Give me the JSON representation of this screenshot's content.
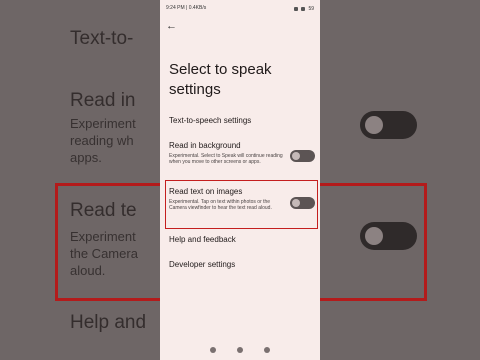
{
  "status_bar": {
    "time": "9:24 PM | 0.4KB/s",
    "battery": "59"
  },
  "screen": {
    "title": "Select to speak settings",
    "back_icon": "arrow-left-icon",
    "items": [
      {
        "label": "Text-to-speech settings"
      },
      {
        "label": "Read in background",
        "description": "Experimental. Select to Speak will continue reading when you move to other screens or apps.",
        "toggle_on": false
      },
      {
        "label": "Read text on images",
        "description": "Experimental. Tap on text within photos or the Camera viewfinder to hear the text read aloud.",
        "toggle_on": false
      },
      {
        "label": "Help and feedback"
      },
      {
        "label": "Developer settings"
      }
    ],
    "highlight_color": "#c41e1e"
  },
  "background_zoom": {
    "left": {
      "line1": "Text-to-",
      "line2": "Read in",
      "line3": "Experiment",
      "line4": "reading wh",
      "line5": "apps.",
      "line6": "Read te",
      "line7": "Experiment",
      "line8": "the Camera",
      "line9": "aloud.",
      "line10": "Help and"
    }
  }
}
